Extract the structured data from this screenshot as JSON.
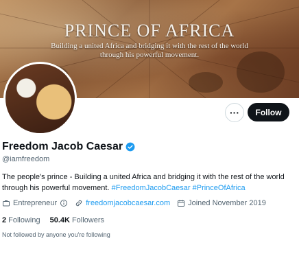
{
  "banner": {
    "title": "PRINCE OF AFRICA",
    "subtitle_line1": "Building a united Africa and bridging it with the rest of the world",
    "subtitle_line2": "through his powerful movement."
  },
  "actions": {
    "more_label": "···",
    "follow_label": "Follow"
  },
  "profile": {
    "display_name": "Freedom Jacob Caesar",
    "handle": "@iamfreedom",
    "bio_text": "The people's prince - Building a united Africa and bridging it with the rest of the world through his powerful movement. ",
    "bio_tag1": "#FreedomJacobCaesar",
    "bio_tag2": "#PrinceOfAfrica"
  },
  "meta": {
    "category": "Entrepreneur",
    "website": "freedomjacobcaesar.com",
    "joined": "Joined November 2019"
  },
  "stats": {
    "following_count": "2",
    "following_label": "Following",
    "followers_count": "50.4K",
    "followers_label": "Followers"
  },
  "followed_by": "Not followed by anyone you're following",
  "colors": {
    "accent": "#1d9bf0",
    "follow_bg": "#0f1419",
    "secondary_text": "#536471"
  },
  "icons": [
    "more-icon",
    "verified-icon",
    "briefcase-icon",
    "info-icon",
    "link-icon",
    "calendar-icon"
  ]
}
